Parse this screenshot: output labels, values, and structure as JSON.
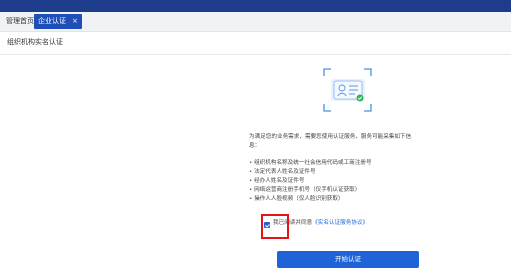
{
  "tabs": {
    "home_label": "管理首页",
    "active_label": "企业认证",
    "close_glyph": "×"
  },
  "page": {
    "title": "组织机构实名认证"
  },
  "content": {
    "description": "为满足您的业务需求，需要您使用认证服务，服务可能采集如下信息：",
    "items": [
      "组织机构名称及统一社会信用代码或工商注册号",
      "法定代表人姓名及证件号",
      "经办人姓名及证件号",
      "网络运营商注册手机号（仅手机认证获取）",
      "操作人人脸视频（仅人脸识别获取）"
    ],
    "agree_prefix": "我已阅读并同意",
    "agree_link": "《实名认证服务协议》",
    "start_button": "开始认证"
  },
  "colors": {
    "topbar": "#1e3c8c",
    "accent": "#1e63d8",
    "highlight": "#e4141b",
    "success": "#2fb457"
  },
  "icons": {
    "illustration": "id-card-verify-icon",
    "checkbox": "checkbox-checked-icon",
    "close": "close-icon"
  }
}
